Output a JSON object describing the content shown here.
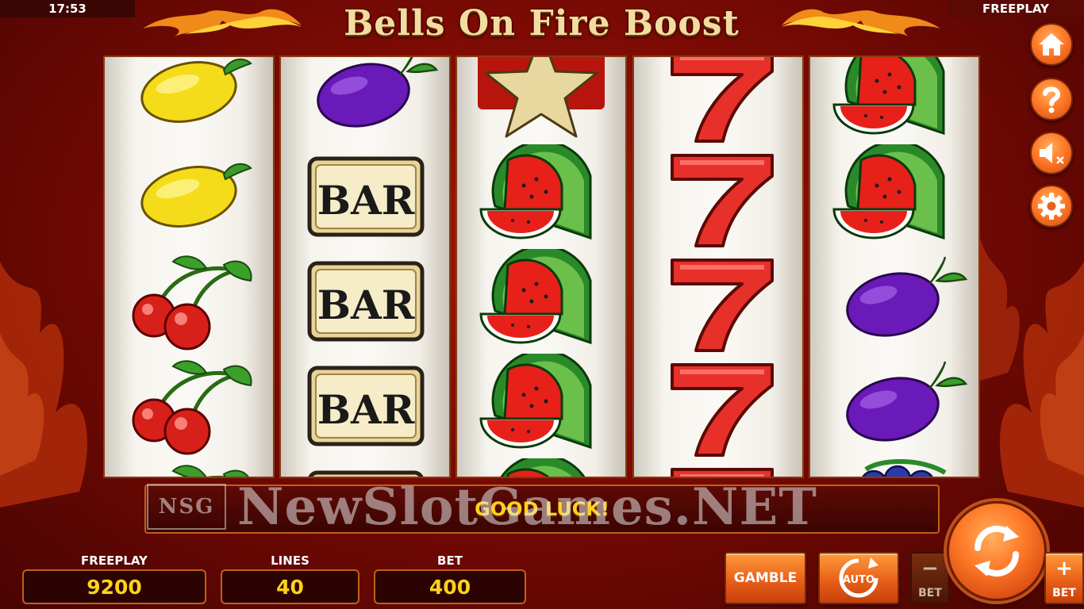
{
  "status_bar": {
    "clock": "17:53",
    "mode": "FREEPLAY"
  },
  "title": "Bells On Fire Boost",
  "reels": [
    [
      "lemon",
      "lemon",
      "cherries",
      "cherries",
      "cherries"
    ],
    [
      "plum",
      "bar",
      "bar",
      "bar",
      "bar"
    ],
    [
      "star",
      "watermelon",
      "watermelon",
      "watermelon",
      "watermelon"
    ],
    [
      "seven",
      "seven",
      "seven",
      "seven",
      "seven"
    ],
    [
      "watermelon",
      "watermelon",
      "plum",
      "plum",
      "grapes"
    ]
  ],
  "bar_label": "BAR",
  "info_message": "GOOD LUCK!",
  "watermark": {
    "logo": "NSG",
    "text": "NewSlotGames.NET"
  },
  "stats": {
    "balance": {
      "label": "FREEPLAY",
      "value": "9200"
    },
    "lines": {
      "label": "LINES",
      "value": "40"
    },
    "bet": {
      "label": "BET",
      "value": "400"
    }
  },
  "buttons": {
    "gamble": "GAMBLE",
    "auto": "AUTO",
    "bet_minus_sign": "−",
    "bet_minus_label": "BET",
    "bet_plus_sign": "+",
    "bet_plus_label": "BET"
  },
  "side_menu": [
    "home-icon",
    "help-icon",
    "sound-muted-icon",
    "settings-icon"
  ],
  "colors": {
    "accent": "#ff7a28",
    "highlight": "#ffd21a",
    "frame": "#c0601a"
  }
}
